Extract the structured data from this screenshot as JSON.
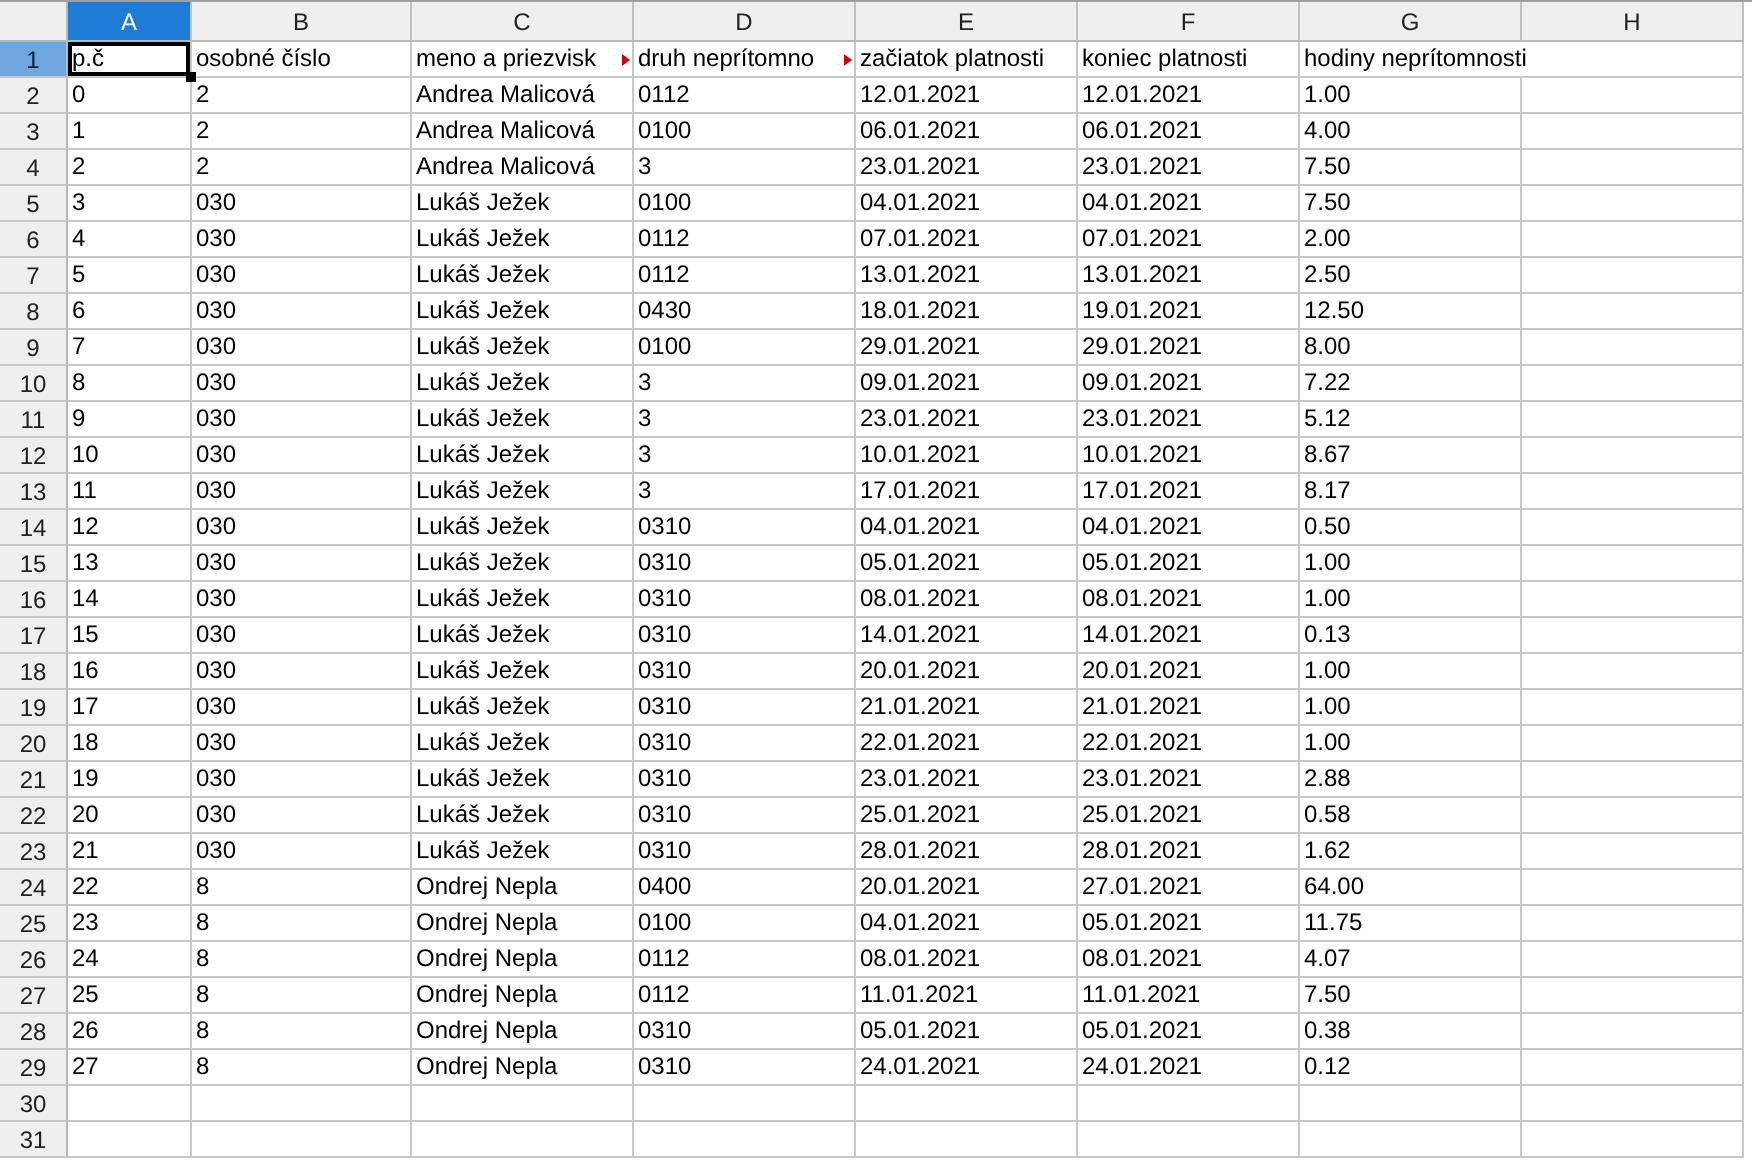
{
  "columns": [
    {
      "label": "A",
      "selected": true
    },
    {
      "label": "B",
      "selected": false
    },
    {
      "label": "C",
      "selected": false
    },
    {
      "label": "D",
      "selected": false
    },
    {
      "label": "E",
      "selected": false
    },
    {
      "label": "F",
      "selected": false
    },
    {
      "label": "G",
      "selected": false
    },
    {
      "label": "H",
      "selected": false
    }
  ],
  "rows": [
    {
      "number": "1",
      "selected": true,
      "cells": [
        {
          "text": "p.č",
          "clipped": false
        },
        {
          "text": "osobné číslo",
          "clipped": false
        },
        {
          "text": "meno a priezvisk",
          "clipped": true
        },
        {
          "text": "druh neprítomno",
          "clipped": true
        },
        {
          "text": "začiatok platnosti",
          "clipped": false
        },
        {
          "text": "koniec platnosti",
          "clipped": false
        },
        {
          "text": "hodiny neprítomnosti",
          "clipped": false
        }
      ]
    },
    {
      "number": "2",
      "selected": false,
      "cells": [
        "0",
        "2",
        "Andrea Malicová",
        "0112",
        "12.01.2021",
        "12.01.2021",
        "1.00"
      ]
    },
    {
      "number": "3",
      "selected": false,
      "cells": [
        "1",
        "2",
        "Andrea Malicová",
        "0100",
        "06.01.2021",
        "06.01.2021",
        "4.00"
      ]
    },
    {
      "number": "4",
      "selected": false,
      "cells": [
        "2",
        "2",
        "Andrea Malicová",
        "3",
        "23.01.2021",
        "23.01.2021",
        "7.50"
      ]
    },
    {
      "number": "5",
      "selected": false,
      "cells": [
        "3",
        "030",
        "Lukáš Ježek",
        "0100",
        "04.01.2021",
        "04.01.2021",
        "7.50"
      ]
    },
    {
      "number": "6",
      "selected": false,
      "cells": [
        "4",
        "030",
        "Lukáš Ježek",
        "0112",
        "07.01.2021",
        "07.01.2021",
        "2.00"
      ]
    },
    {
      "number": "7",
      "selected": false,
      "cells": [
        "5",
        "030",
        "Lukáš Ježek",
        "0112",
        "13.01.2021",
        "13.01.2021",
        "2.50"
      ]
    },
    {
      "number": "8",
      "selected": false,
      "cells": [
        "6",
        "030",
        "Lukáš Ježek",
        "0430",
        "18.01.2021",
        "19.01.2021",
        "12.50"
      ]
    },
    {
      "number": "9",
      "selected": false,
      "cells": [
        "7",
        "030",
        "Lukáš Ježek",
        "0100",
        "29.01.2021",
        "29.01.2021",
        "8.00"
      ]
    },
    {
      "number": "10",
      "selected": false,
      "cells": [
        "8",
        "030",
        "Lukáš Ježek",
        "3",
        "09.01.2021",
        "09.01.2021",
        "7.22"
      ]
    },
    {
      "number": "11",
      "selected": false,
      "cells": [
        "9",
        "030",
        "Lukáš Ježek",
        "3",
        "23.01.2021",
        "23.01.2021",
        "5.12"
      ]
    },
    {
      "number": "12",
      "selected": false,
      "cells": [
        "10",
        "030",
        "Lukáš Ježek",
        "3",
        "10.01.2021",
        "10.01.2021",
        "8.67"
      ]
    },
    {
      "number": "13",
      "selected": false,
      "cells": [
        "11",
        "030",
        "Lukáš Ježek",
        "3",
        "17.01.2021",
        "17.01.2021",
        "8.17"
      ]
    },
    {
      "number": "14",
      "selected": false,
      "cells": [
        "12",
        "030",
        "Lukáš Ježek",
        "0310",
        "04.01.2021",
        "04.01.2021",
        "0.50"
      ]
    },
    {
      "number": "15",
      "selected": false,
      "cells": [
        "13",
        "030",
        "Lukáš Ježek",
        "0310",
        "05.01.2021",
        "05.01.2021",
        "1.00"
      ]
    },
    {
      "number": "16",
      "selected": false,
      "cells": [
        "14",
        "030",
        "Lukáš Ježek",
        "0310",
        "08.01.2021",
        "08.01.2021",
        "1.00"
      ]
    },
    {
      "number": "17",
      "selected": false,
      "cells": [
        "15",
        "030",
        "Lukáš Ježek",
        "0310",
        "14.01.2021",
        "14.01.2021",
        "0.13"
      ]
    },
    {
      "number": "18",
      "selected": false,
      "cells": [
        "16",
        "030",
        "Lukáš Ježek",
        "0310",
        "20.01.2021",
        "20.01.2021",
        "1.00"
      ]
    },
    {
      "number": "19",
      "selected": false,
      "cells": [
        "17",
        "030",
        "Lukáš Ježek",
        "0310",
        "21.01.2021",
        "21.01.2021",
        "1.00"
      ]
    },
    {
      "number": "20",
      "selected": false,
      "cells": [
        "18",
        "030",
        "Lukáš Ježek",
        "0310",
        "22.01.2021",
        "22.01.2021",
        "1.00"
      ]
    },
    {
      "number": "21",
      "selected": false,
      "cells": [
        "19",
        "030",
        "Lukáš Ježek",
        "0310",
        "23.01.2021",
        "23.01.2021",
        "2.88"
      ]
    },
    {
      "number": "22",
      "selected": false,
      "cells": [
        "20",
        "030",
        "Lukáš Ježek",
        "0310",
        "25.01.2021",
        "25.01.2021",
        "0.58"
      ]
    },
    {
      "number": "23",
      "selected": false,
      "cells": [
        "21",
        "030",
        "Lukáš Ježek",
        "0310",
        "28.01.2021",
        "28.01.2021",
        "1.62"
      ]
    },
    {
      "number": "24",
      "selected": false,
      "cells": [
        "22",
        "8",
        "Ondrej Nepla",
        "0400",
        "20.01.2021",
        "27.01.2021",
        "64.00"
      ]
    },
    {
      "number": "25",
      "selected": false,
      "cells": [
        "23",
        "8",
        "Ondrej Nepla",
        "0100",
        "04.01.2021",
        "05.01.2021",
        "11.75"
      ]
    },
    {
      "number": "26",
      "selected": false,
      "cells": [
        "24",
        "8",
        "Ondrej Nepla",
        "0112",
        "08.01.2021",
        "08.01.2021",
        "4.07"
      ]
    },
    {
      "number": "27",
      "selected": false,
      "cells": [
        "25",
        "8",
        "Ondrej Nepla",
        "0112",
        "11.01.2021",
        "11.01.2021",
        "7.50"
      ]
    },
    {
      "number": "28",
      "selected": false,
      "cells": [
        "26",
        "8",
        "Ondrej Nepla",
        "0310",
        "05.01.2021",
        "05.01.2021",
        "0.38"
      ]
    },
    {
      "number": "29",
      "selected": false,
      "cells": [
        "27",
        "8",
        "Ondrej Nepla",
        "0310",
        "24.01.2021",
        "24.01.2021",
        "0.12"
      ]
    },
    {
      "number": "30",
      "selected": false
    },
    {
      "number": "31",
      "selected": false
    }
  ]
}
